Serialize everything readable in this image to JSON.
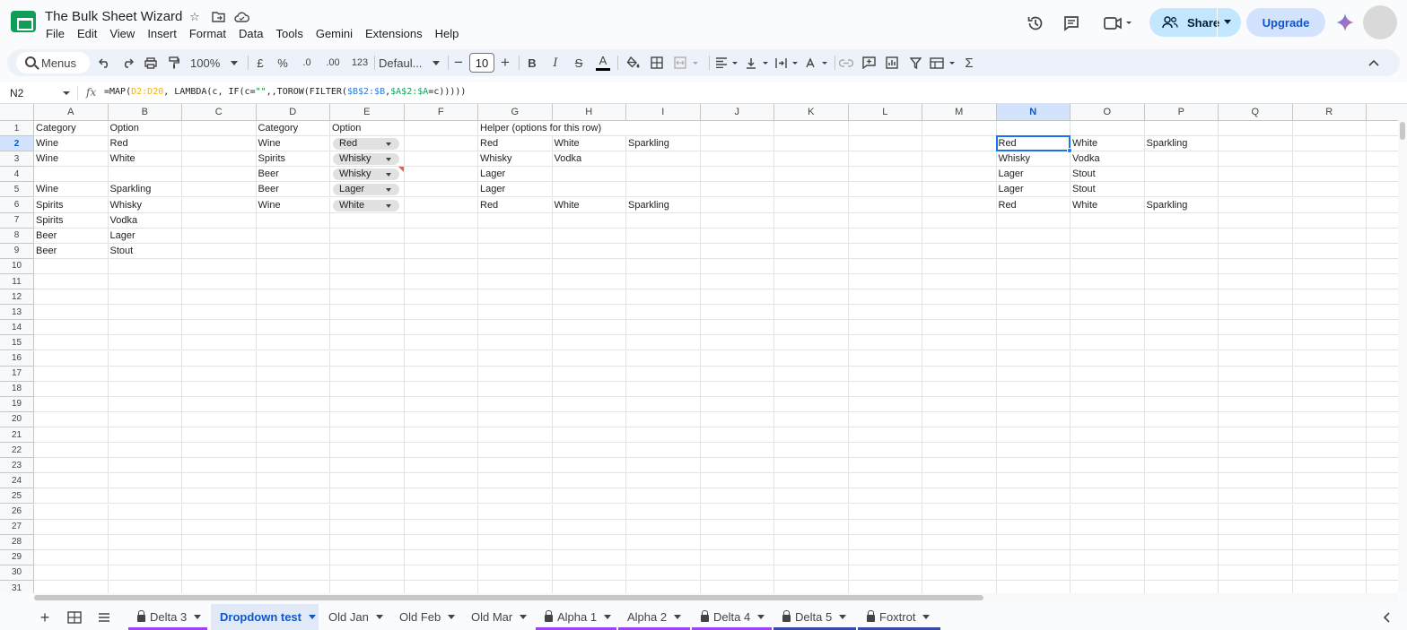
{
  "app": {
    "title": "The Bulk Sheet Wizard",
    "menu": [
      "File",
      "Edit",
      "View",
      "Insert",
      "Format",
      "Data",
      "Tools",
      "Gemini",
      "Extensions",
      "Help"
    ],
    "share_label": "Share",
    "upgrade_label": "Upgrade"
  },
  "toolbar": {
    "search_label": "Menus",
    "zoom": "100%",
    "currency": "£",
    "percent": "%",
    "dec_decrease": ".0",
    "dec_increase": ".00",
    "number_format": "123",
    "font": "Defaul...",
    "font_size": "10",
    "bold": "B",
    "italic": "I",
    "strike": "S",
    "text_color": "A",
    "sum": "Σ"
  },
  "formula_bar": {
    "cell_ref": "N2",
    "fx": "fx",
    "formula_parts": [
      "=MAP(",
      "D2:D20",
      ", LAMBDA(c, IF(c=",
      "\"\"",
      ",,TOROW(FILTER(",
      "$B$2:$B",
      ",",
      "$A$2:$A",
      "=c)))))"
    ]
  },
  "grid": {
    "columns": [
      "A",
      "B",
      "C",
      "D",
      "E",
      "F",
      "G",
      "H",
      "I",
      "J",
      "K",
      "L",
      "M",
      "N",
      "O",
      "P",
      "Q",
      "R"
    ],
    "selected_column": "N",
    "selected_row": 2,
    "row_count": 31,
    "cells": [
      {
        "ref": "A1",
        "v": "Category"
      },
      {
        "ref": "B1",
        "v": "Option"
      },
      {
        "ref": "D1",
        "v": "Category"
      },
      {
        "ref": "E1",
        "v": "Option"
      },
      {
        "ref": "G1",
        "v": "Helper (options for this row)"
      },
      {
        "ref": "A2",
        "v": "Wine"
      },
      {
        "ref": "B2",
        "v": "Red"
      },
      {
        "ref": "D2",
        "v": "Wine"
      },
      {
        "ref": "E2",
        "v": "Red",
        "chip": true
      },
      {
        "ref": "G2",
        "v": "Red"
      },
      {
        "ref": "H2",
        "v": "White"
      },
      {
        "ref": "I2",
        "v": "Sparkling"
      },
      {
        "ref": "N2",
        "v": "Red"
      },
      {
        "ref": "O2",
        "v": "White"
      },
      {
        "ref": "P2",
        "v": "Sparkling"
      },
      {
        "ref": "A3",
        "v": "Wine"
      },
      {
        "ref": "B3",
        "v": "White"
      },
      {
        "ref": "D3",
        "v": "Spirits"
      },
      {
        "ref": "E3",
        "v": "Whisky",
        "chip": true
      },
      {
        "ref": "G3",
        "v": "Whisky"
      },
      {
        "ref": "H3",
        "v": "Vodka"
      },
      {
        "ref": "N3",
        "v": "Whisky"
      },
      {
        "ref": "O3",
        "v": "Vodka"
      },
      {
        "ref": "D4",
        "v": "Beer"
      },
      {
        "ref": "E4",
        "v": "Whisky",
        "chip": true,
        "note": true
      },
      {
        "ref": "G4",
        "v": "Lager"
      },
      {
        "ref": "N4",
        "v": "Lager"
      },
      {
        "ref": "O4",
        "v": "Stout"
      },
      {
        "ref": "A5",
        "v": "Wine"
      },
      {
        "ref": "B5",
        "v": "Sparkling"
      },
      {
        "ref": "D5",
        "v": "Beer"
      },
      {
        "ref": "E5",
        "v": "Lager",
        "chip": true
      },
      {
        "ref": "G5",
        "v": "Lager"
      },
      {
        "ref": "N5",
        "v": "Lager"
      },
      {
        "ref": "O5",
        "v": "Stout"
      },
      {
        "ref": "A6",
        "v": "Spirits"
      },
      {
        "ref": "B6",
        "v": "Whisky"
      },
      {
        "ref": "D6",
        "v": "Wine"
      },
      {
        "ref": "E6",
        "v": "White",
        "chip": true
      },
      {
        "ref": "G6",
        "v": "Red"
      },
      {
        "ref": "H6",
        "v": "White"
      },
      {
        "ref": "I6",
        "v": "Sparkling"
      },
      {
        "ref": "N6",
        "v": "Red"
      },
      {
        "ref": "O6",
        "v": "White"
      },
      {
        "ref": "P6",
        "v": "Sparkling"
      },
      {
        "ref": "A7",
        "v": "Spirits"
      },
      {
        "ref": "B7",
        "v": "Vodka"
      },
      {
        "ref": "A8",
        "v": "Beer"
      },
      {
        "ref": "B8",
        "v": "Lager"
      },
      {
        "ref": "A9",
        "v": "Beer"
      },
      {
        "ref": "B9",
        "v": "Stout"
      }
    ]
  },
  "sheet_tabs": [
    {
      "name": "Delta 3",
      "locked": true,
      "underline": "#a142f4"
    },
    {
      "name": "Dropdown test",
      "locked": false,
      "active": true
    },
    {
      "name": "Old Jan",
      "locked": false
    },
    {
      "name": "Old Feb",
      "locked": false
    },
    {
      "name": "Old Mar",
      "locked": false
    },
    {
      "name": "Alpha 1",
      "locked": true,
      "underline": "#a142f4"
    },
    {
      "name": "Alpha 2",
      "locked": false,
      "underline": "#a142f4"
    },
    {
      "name": "Delta 4",
      "locked": true,
      "underline": "#a142f4"
    },
    {
      "name": "Delta 5",
      "locked": true,
      "underline": "#3949ab"
    },
    {
      "name": "Foxtrot",
      "locked": true,
      "underline": "#3949ab"
    }
  ],
  "colors": {
    "accent": "#0b57d0",
    "selection": "#1a73e8",
    "share_bg": "#c2e7ff",
    "upgrade_bg": "#d3e3fd"
  }
}
